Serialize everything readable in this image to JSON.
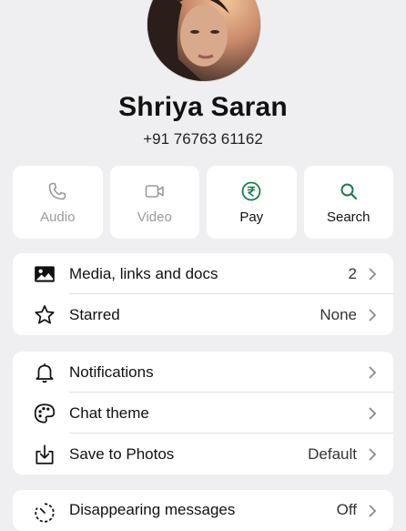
{
  "profile": {
    "name": "Shriya Saran",
    "phone": "+91 76763 61162"
  },
  "actions": [
    {
      "label": "Audio",
      "icon": "phone-icon",
      "enabled": false
    },
    {
      "label": "Video",
      "icon": "video-icon",
      "enabled": false
    },
    {
      "label": "Pay",
      "icon": "rupee-icon",
      "enabled": true
    },
    {
      "label": "Search",
      "icon": "search-icon",
      "enabled": true
    }
  ],
  "section1": [
    {
      "label": "Media, links and docs",
      "value": "2",
      "icon": "image-icon"
    },
    {
      "label": "Starred",
      "value": "None",
      "icon": "star-icon"
    }
  ],
  "section2": [
    {
      "label": "Notifications",
      "value": "",
      "icon": "bell-icon"
    },
    {
      "label": "Chat theme",
      "value": "",
      "icon": "palette-icon"
    },
    {
      "label": "Save to Photos",
      "value": "Default",
      "icon": "download-icon"
    }
  ],
  "section3": [
    {
      "label": "Disappearing messages",
      "value": "Off",
      "icon": "timer-icon"
    }
  ],
  "colors": {
    "accent": "#1a7d4a",
    "background": "#efeff1",
    "disabled": "#9a9a9a"
  }
}
